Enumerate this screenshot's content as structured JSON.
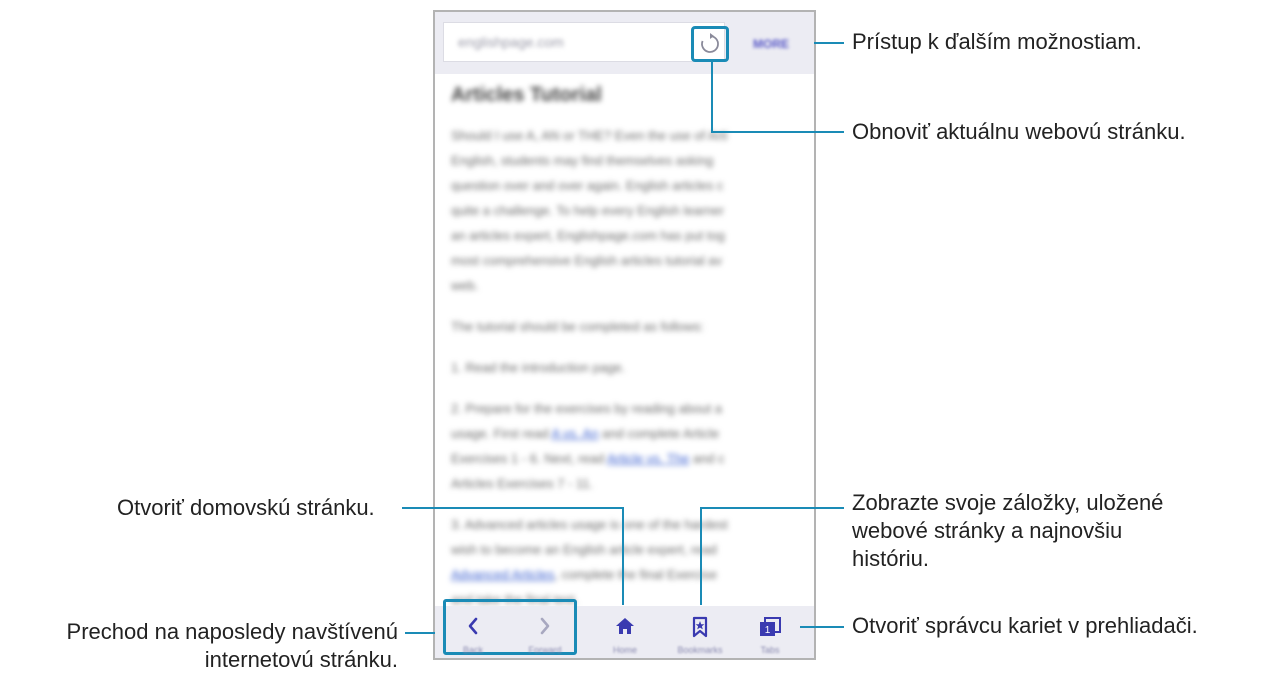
{
  "browser": {
    "url": "englishpage.com",
    "more_label": "MORE",
    "article": {
      "title": "Articles Tutorial",
      "paragraph1": [
        "Should I use A, AN or THE? Even the use of Arti",
        "English, students may find themselves asking",
        "question over and over again. English articles c",
        "quite a challenge. To help every English learner",
        "an articles expert, Englishpage.com has put tog",
        "most comprehensive English articles tutorial av",
        "web."
      ],
      "paragraph2": "The tutorial should be completed as follows:",
      "paragraph3": "1. Read the introduction page.",
      "paragraph4_lines": [
        "2. Prepare for the exercises by reading about a",
        "usage. First read",
        "Exercises 1 - 6. Next, read",
        "Articles Exercises 7 - 11."
      ],
      "paragraph4_links": [
        "A vs. An",
        "Article vs. The"
      ],
      "paragraph4_after_links": [
        " and complete Article",
        " and c"
      ],
      "paragraph5": [
        "3. Advanced articles usage is one of the hardest",
        "wish to become an English article expert, read",
        "Advanced Articles",
        ", complete the final Exercise",
        "and take the final test."
      ]
    },
    "toolbar": {
      "back_label": "Back",
      "forward_label": "Forward",
      "home_label": "Home",
      "bookmarks_label": "Bookmarks",
      "tabs_label": "Tabs",
      "tabs_count": "1"
    }
  },
  "callouts": {
    "more": "Prístup k ďalším možnostiam.",
    "refresh": "Obnoviť aktuálnu webovú stránku.",
    "home": "Otvoriť domovskú stránku.",
    "bookmarks_line1": "Zobrazte svoje záložky, uložené",
    "bookmarks_line2": "webové stránky a najnovšiu",
    "bookmarks_line3": "históriu.",
    "nav_line1": "Prechod na naposledy navštívenú",
    "nav_line2": "internetovú stránku.",
    "tabs": "Otvoriť správcu kariet v prehliadači."
  },
  "colors": {
    "accent": "#1a8bb6",
    "toolbar_bg": "#ececf3",
    "icon": "#3a3ab0"
  }
}
